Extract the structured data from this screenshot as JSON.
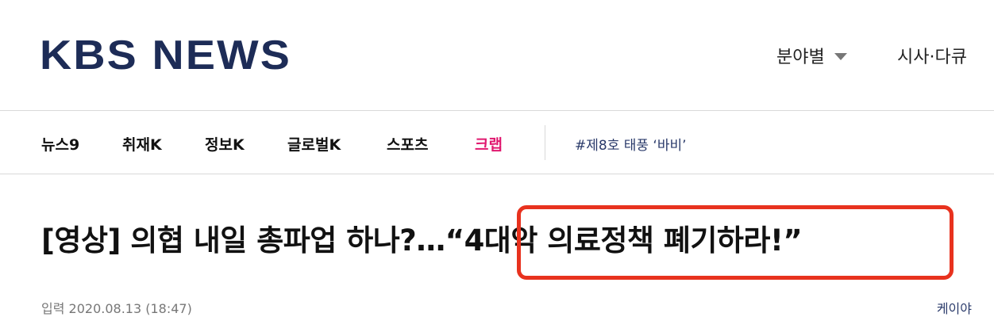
{
  "header": {
    "logo_text": "KBS NEWS",
    "category_menu_label": "분야별",
    "documentary_menu_label": "시사·다큐"
  },
  "nav": {
    "items": [
      {
        "label": "뉴스9"
      },
      {
        "label": "취재K"
      },
      {
        "label": "정보K"
      },
      {
        "label": "글로벌K"
      },
      {
        "label": "스포츠"
      },
      {
        "label": "크랩"
      }
    ],
    "tag": "#제8호 태풍 ‘바비’"
  },
  "article": {
    "headline_prefix": "[영상] 의협 내일 총파업 하나?…",
    "headline_quote": "“4대악 의료정책 폐기하라!”",
    "date": "입력 2020.08.13 (18:47)",
    "author": "케이야"
  },
  "colors": {
    "logo": "#1d2c57",
    "accent_nav": "#e0186f",
    "highlight_box": "#e8321e"
  }
}
